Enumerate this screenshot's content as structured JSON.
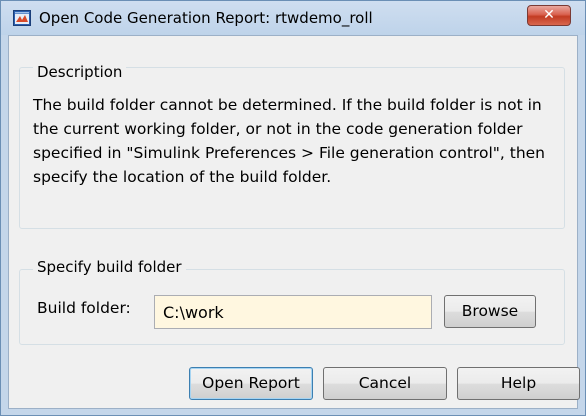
{
  "window": {
    "title": "Open Code Generation Report: rtwdemo_roll",
    "close_glyph": "✕",
    "app_icon": "simulink-model-icon"
  },
  "description": {
    "label": "Description",
    "text": "The build folder cannot be determined. If the build folder is not in the current working folder, or not in the code generation folder specified in \"Simulink Preferences > File generation control\", then specify the location of the build folder."
  },
  "build": {
    "label": "Specify build folder",
    "field_label": "Build folder:",
    "folder_value": "C:\\work",
    "browse_label": "Browse"
  },
  "buttons": {
    "open_report": "Open Report",
    "cancel": "Cancel",
    "help": "Help"
  },
  "colors": {
    "input_background": "#fff7e0",
    "close_button": "#c23b22",
    "titlebar": "#c4d6ea"
  }
}
